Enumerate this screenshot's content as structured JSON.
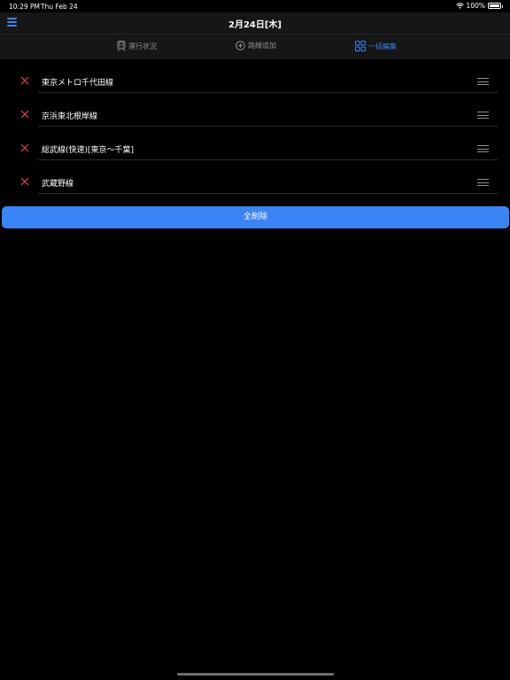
{
  "status_bar": {
    "time": "10:29 PM",
    "date": "Thu Feb 24",
    "battery_percent": "100%",
    "wifi_icon": "wifi-icon",
    "battery_icon": "battery-icon"
  },
  "nav": {
    "title": "2月24日[木]",
    "menu_icon": "hamburger-menu-icon"
  },
  "tabs": [
    {
      "label": "運行状況",
      "icon": "train-icon",
      "active": false
    },
    {
      "label": "路線追加",
      "icon": "plus-circle-icon",
      "active": false
    },
    {
      "label": "一括編集",
      "icon": "grid-icon",
      "active": true
    }
  ],
  "lines": [
    {
      "label": "東京メトロ千代田線"
    },
    {
      "label": "京浜東北根岸線"
    },
    {
      "label": "総武線(快速)[東京～千葉]"
    },
    {
      "label": "武蔵野線"
    }
  ],
  "delete_all_label": "全削除",
  "colors": {
    "accent": "#3a84f5",
    "delete": "#e8424f",
    "background": "#000000",
    "bar": "#161616"
  }
}
